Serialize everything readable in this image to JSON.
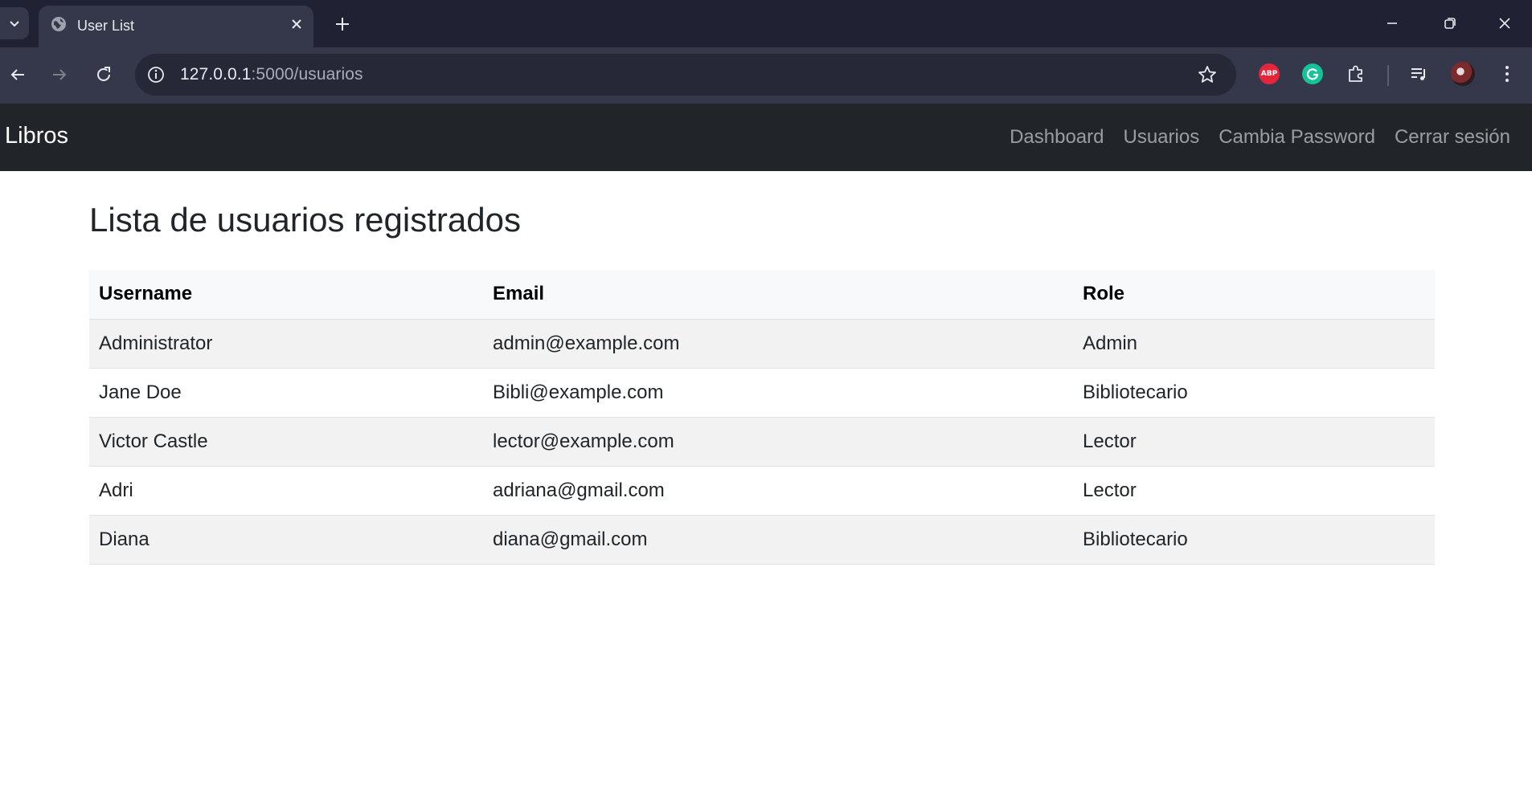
{
  "browser": {
    "tab": {
      "title": "User List"
    },
    "address_bar": {
      "host": "127.0.0.1",
      "path": ":5000/usuarios"
    },
    "extensions": {
      "adblock_label": "ABP"
    }
  },
  "navbar": {
    "brand": "Libros",
    "links": [
      "Dashboard",
      "Usuarios",
      "Cambia Password",
      "Cerrar sesión"
    ]
  },
  "main": {
    "title": "Lista de usuarios registrados",
    "table": {
      "headers": [
        "Username",
        "Email",
        "Role"
      ],
      "rows": [
        [
          "Administrator",
          "admin@example.com",
          "Admin"
        ],
        [
          "Jane Doe",
          "Bibli@example.com",
          "Bibliotecario"
        ],
        [
          "Victor Castle",
          "lector@example.com",
          "Lector"
        ],
        [
          "Adri",
          "adriana@gmail.com",
          "Lector"
        ],
        [
          "Diana",
          "diana@gmail.com",
          "Bibliotecario"
        ]
      ]
    }
  },
  "colors": {
    "tabbar_bg": "#202233",
    "toolbar_bg": "#35384a",
    "navbar_bg": "#212529",
    "stripe_bg": "#f2f2f2"
  }
}
